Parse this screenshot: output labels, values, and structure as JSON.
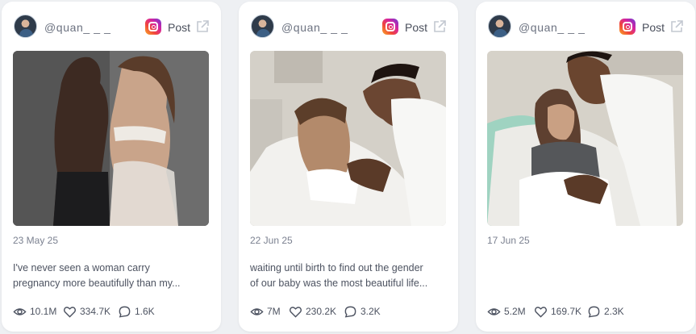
{
  "cards": [
    {
      "handle": "@quan_ _ _",
      "post_label": "Post",
      "date": "23 May 25",
      "caption_line1": "I've never seen a woman carry",
      "caption_line2": "pregnancy more beautifully than my...",
      "views": "10.1M",
      "likes": "334.7K",
      "comments": "1.6K"
    },
    {
      "handle": "@quan_ _ _",
      "post_label": "Post",
      "date": "22 Jun 25",
      "caption_line1": "waiting until birth to find out the gender",
      "caption_line2": "of our baby was the most beautiful life...",
      "views": "7M",
      "likes": "230.2K",
      "comments": "3.2K"
    },
    {
      "handle": "@quan_ _ _",
      "post_label": "Post",
      "date": "17 Jun 25",
      "caption_line1": "",
      "caption_line2": "",
      "views": "5.2M",
      "likes": "169.7K",
      "comments": "2.3K"
    }
  ],
  "icons": {
    "platform": "instagram-icon",
    "external": "external-link-icon",
    "views": "eye-icon",
    "likes": "heart-icon",
    "comments": "comment-icon"
  },
  "colors": {
    "background": "#eef0f3",
    "card": "#ffffff",
    "text": "#4d5361"
  }
}
